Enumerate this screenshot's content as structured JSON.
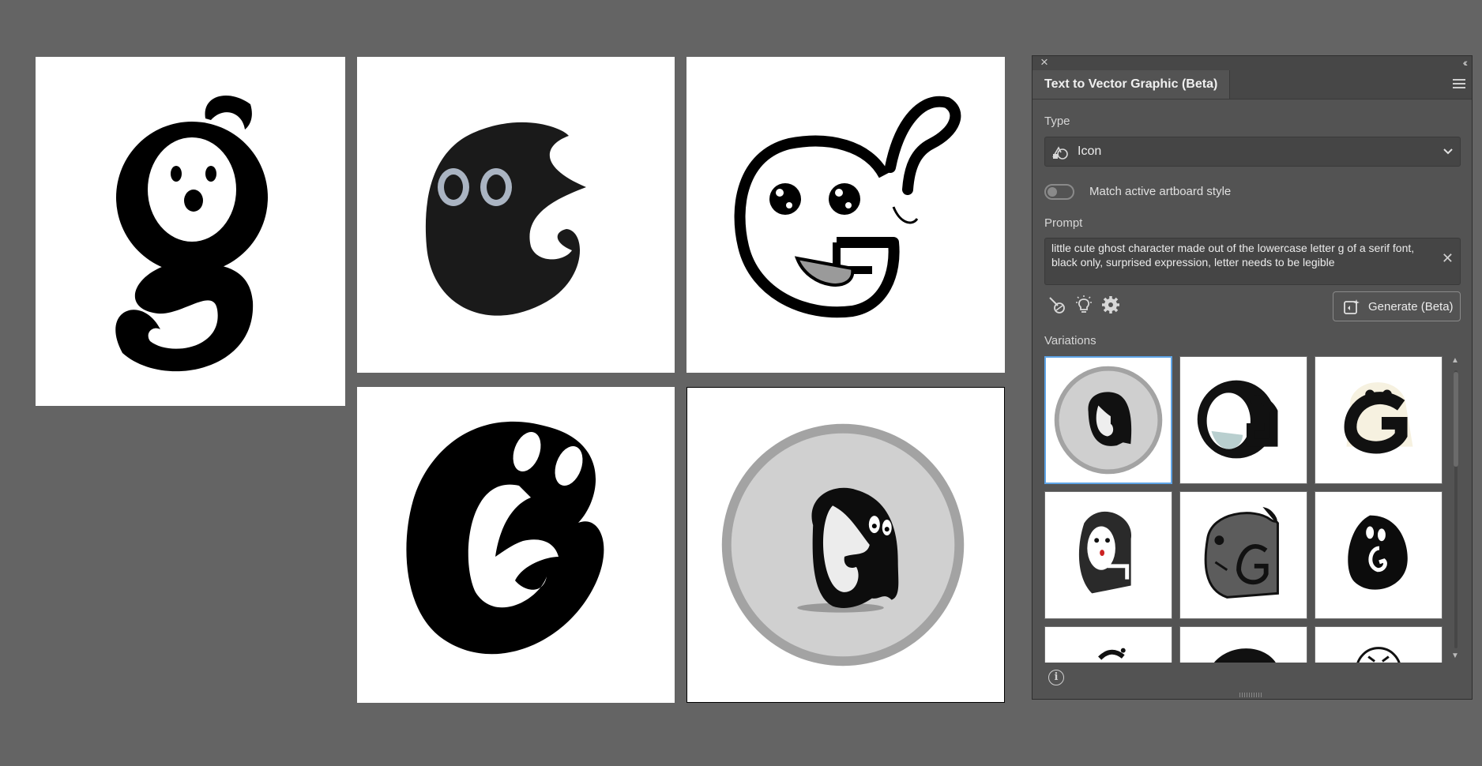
{
  "panel": {
    "tab_title": "Text to Vector Graphic (Beta)",
    "type_label": "Type",
    "type_value": "Icon",
    "match_style_label": "Match active artboard style",
    "match_style_on": false,
    "prompt_label": "Prompt",
    "prompt_text": "little cute ghost character made out of the lowercase letter g of a serif font, black only, surprised expression, letter needs to be legible",
    "generate_label": "Generate (Beta)",
    "variations_label": "Variations",
    "selected_variation": 1
  },
  "icons": [
    "close-icon",
    "collapse-icon",
    "panel-menu-icon",
    "icon-type-icon",
    "chevron-down-icon",
    "clear-icon",
    "style-picker-icon",
    "lightbulb-icon",
    "settings-icon",
    "generate-icon",
    "info-icon"
  ],
  "colors": {
    "canvas": "#646464",
    "panel": "#535353",
    "selection": "#5ea4e6"
  }
}
